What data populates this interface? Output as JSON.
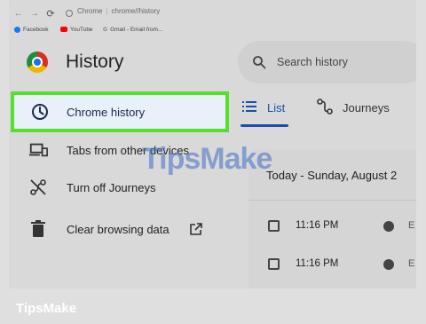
{
  "browser": {
    "url_domain": "Chrome",
    "url_path": "chrome//history",
    "bookmarks": [
      {
        "label": "Facebook",
        "color": "#1877f2"
      },
      {
        "label": "YouTube",
        "color": "#ff0000"
      },
      {
        "label": "Gmail - Email from...",
        "color": "#777777"
      }
    ]
  },
  "header": {
    "title": "History",
    "search_placeholder": "Search history"
  },
  "sidebar": {
    "items": [
      {
        "label": "Chrome history",
        "icon": "clock-icon",
        "active": true
      },
      {
        "label": "Tabs from other devices",
        "icon": "devices-icon"
      },
      {
        "label": "Turn off Journeys",
        "icon": "journeys-off-icon"
      },
      {
        "label": "Clear browsing data",
        "icon": "trash-icon"
      }
    ]
  },
  "tabs": [
    {
      "label": "List",
      "icon": "list-icon",
      "active": true
    },
    {
      "label": "Journeys",
      "icon": "journeys-icon"
    }
  ],
  "history": {
    "date_heading": "Today - Sunday, August 2",
    "rows": [
      {
        "time": "11:16 PM",
        "title": "E"
      },
      {
        "time": "11:16 PM",
        "title": "E"
      }
    ]
  },
  "watermark": "TipsMake",
  "footer": "TipsMake",
  "colors": {
    "active_border": "#56e02d",
    "active_bg": "#e8f0fa",
    "accent": "#1a4fa8"
  }
}
